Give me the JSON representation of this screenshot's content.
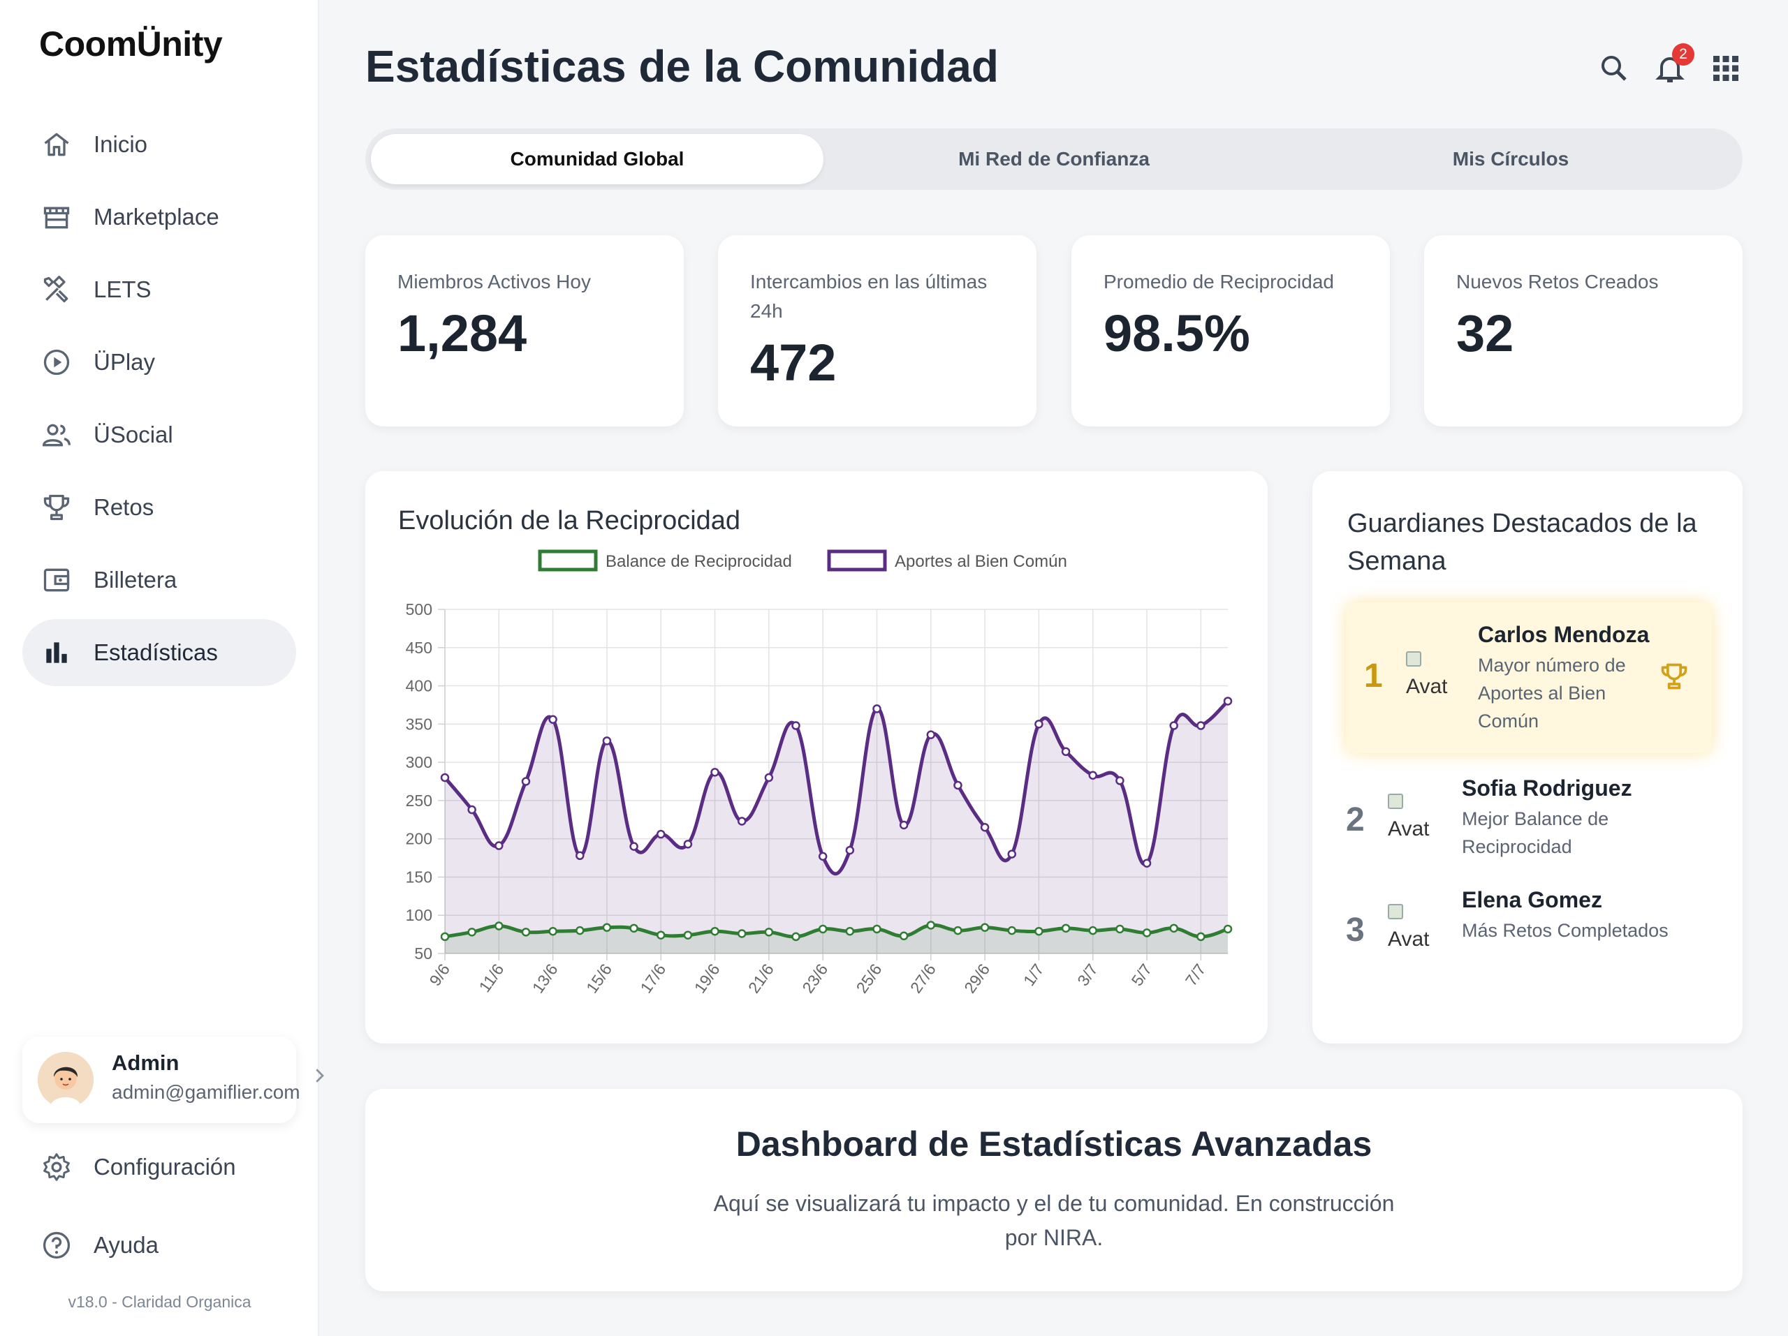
{
  "app": {
    "name": "CoomÜnity",
    "version": "v18.0 - Claridad Organica"
  },
  "sidebar": {
    "items": [
      {
        "label": "Inicio",
        "icon": "home-icon"
      },
      {
        "label": "Marketplace",
        "icon": "store-icon"
      },
      {
        "label": "LETS",
        "icon": "tools-icon"
      },
      {
        "label": "ÜPlay",
        "icon": "play-circle-icon"
      },
      {
        "label": "ÜSocial",
        "icon": "people-icon"
      },
      {
        "label": "Retos",
        "icon": "trophy-icon"
      },
      {
        "label": "Billetera",
        "icon": "wallet-icon"
      },
      {
        "label": "Estadísticas",
        "icon": "bar-chart-icon",
        "active": true
      }
    ],
    "user": {
      "name": "Admin",
      "email": "admin@gamiflier.com"
    },
    "config_label": "Configuración",
    "help_label": "Ayuda"
  },
  "header": {
    "title": "Estadísticas de la Comunidad",
    "notification_count": "2"
  },
  "tabs": [
    {
      "label": "Comunidad Global",
      "active": true
    },
    {
      "label": "Mi Red de Confianza"
    },
    {
      "label": "Mis Círculos"
    }
  ],
  "stats": [
    {
      "label": "Miembros Activos Hoy",
      "value": "1,284"
    },
    {
      "label": "Intercambios en las últimas 24h",
      "value": "472"
    },
    {
      "label": "Promedio de Reciprocidad",
      "value": "98.5%"
    },
    {
      "label": "Nuevos Retos Creados",
      "value": "32"
    }
  ],
  "chart_card": {
    "title": "Evolución de la Reciprocidad"
  },
  "chart_data": {
    "type": "line",
    "title": "Evolución de la Reciprocidad",
    "x": [
      "9/6",
      "10/6",
      "11/6",
      "12/6",
      "13/6",
      "14/6",
      "15/6",
      "16/6",
      "17/6",
      "18/6",
      "19/6",
      "20/6",
      "21/6",
      "22/6",
      "23/6",
      "24/6",
      "25/6",
      "26/6",
      "27/6",
      "28/6",
      "29/6",
      "30/6",
      "1/7",
      "2/7",
      "3/7",
      "4/7",
      "5/7",
      "6/7",
      "7/7",
      "8/7"
    ],
    "xtick_labels": [
      "9/6",
      "11/6",
      "13/6",
      "15/6",
      "17/6",
      "19/6",
      "21/6",
      "23/6",
      "25/6",
      "27/6",
      "29/6",
      "1/7",
      "3/7",
      "5/7",
      "7/7"
    ],
    "ylim": [
      50,
      500
    ],
    "yticks": [
      50,
      100,
      150,
      200,
      250,
      300,
      350,
      400,
      450,
      500
    ],
    "legend_position": "top-center",
    "grid": true,
    "series": [
      {
        "name": "Balance de Reciprocidad",
        "color": "#2e7d32",
        "values": [
          72,
          78,
          86,
          78,
          79,
          80,
          84,
          83,
          74,
          74,
          79,
          76,
          78,
          72,
          82,
          79,
          82,
          73,
          87,
          80,
          84,
          80,
          79,
          83,
          80,
          82,
          77,
          83,
          72,
          82
        ]
      },
      {
        "name": "Aportes al Bien Común",
        "color": "#5b2c83",
        "values": [
          280,
          238,
          191,
          275,
          356,
          178,
          328,
          190,
          206,
          193,
          287,
          223,
          280,
          348,
          177,
          185,
          370,
          218,
          336,
          270,
          215,
          180,
          350,
          314,
          283,
          276,
          168,
          348,
          348,
          380
        ]
      }
    ]
  },
  "guardians": {
    "title": "Guardianes Destacados de la Semana",
    "avatar_alt": "Avatar",
    "items": [
      {
        "rank": "1",
        "name": "Carlos Mendoza",
        "desc": "Mayor número de Aportes al Bien Común",
        "trophy_color": "#d4a017"
      },
      {
        "rank": "2",
        "name": "Sofia Rodriguez",
        "desc": "Mejor Balance de Reciprocidad"
      },
      {
        "rank": "3",
        "name": "Elena Gomez",
        "desc": "Más Retos Completados"
      }
    ]
  },
  "dashboard": {
    "title": "Dashboard de Estadísticas Avanzadas",
    "text": "Aquí se visualizará tu impacto y el de tu comunidad. En construcción por NIRA."
  }
}
